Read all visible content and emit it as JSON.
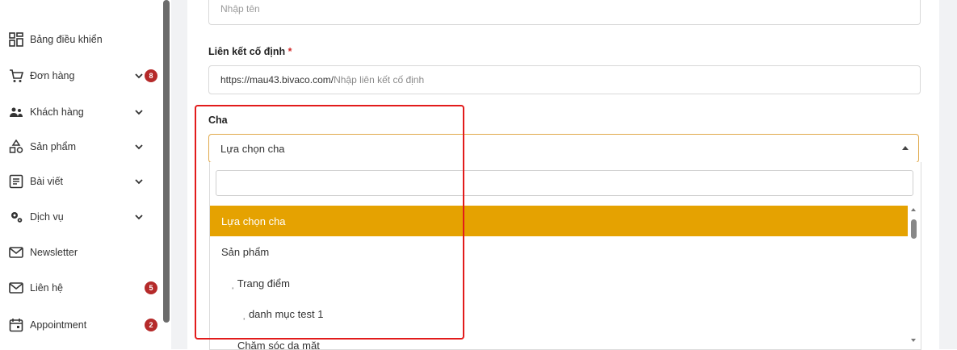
{
  "sidebar": {
    "items": [
      {
        "label": "Bảng điều khiển",
        "icon": "dashboard-icon",
        "chevron": false,
        "badge": ""
      },
      {
        "label": "Đơn hàng",
        "icon": "cart-icon",
        "chevron": true,
        "badge": "8"
      },
      {
        "label": "Khách hàng",
        "icon": "users-icon",
        "chevron": true,
        "badge": ""
      },
      {
        "label": "Sản phẩm",
        "icon": "shapes-icon",
        "chevron": true,
        "badge": ""
      },
      {
        "label": "Bài viết",
        "icon": "article-icon",
        "chevron": true,
        "badge": ""
      },
      {
        "label": "Dịch vụ",
        "icon": "gears-icon",
        "chevron": true,
        "badge": ""
      },
      {
        "label": "Newsletter",
        "icon": "mail-icon",
        "chevron": false,
        "badge": ""
      },
      {
        "label": "Liên hệ",
        "icon": "mail-icon",
        "chevron": false,
        "badge": "5"
      },
      {
        "label": "Appointment",
        "icon": "calendar-icon",
        "chevron": false,
        "badge": "2"
      }
    ]
  },
  "form": {
    "name_placeholder": "Nhập tên",
    "permalink": {
      "label": "Liên kết cố định",
      "required_mark": "*",
      "prefix": "https://mau43.bivaco.com/",
      "placeholder": "Nhập liên kết cố định"
    },
    "parent": {
      "label": "Cha",
      "selected": "Lựa chọn cha",
      "search_value": "",
      "options": [
        {
          "label": "Lựa chọn cha",
          "selected": true
        },
        {
          "label": "Sản phẩm",
          "selected": false
        },
        {
          "label": "ˌ Trang điểm",
          "selected": false
        },
        {
          "label": "ˌ danh mục test 1",
          "selected": false
        },
        {
          "label": "ˌ Chăm sóc da mặt",
          "selected": false
        }
      ]
    }
  },
  "colors": {
    "accent": "#e5a201",
    "badge": "#b52a2a",
    "highlight": "#e21b1b"
  }
}
